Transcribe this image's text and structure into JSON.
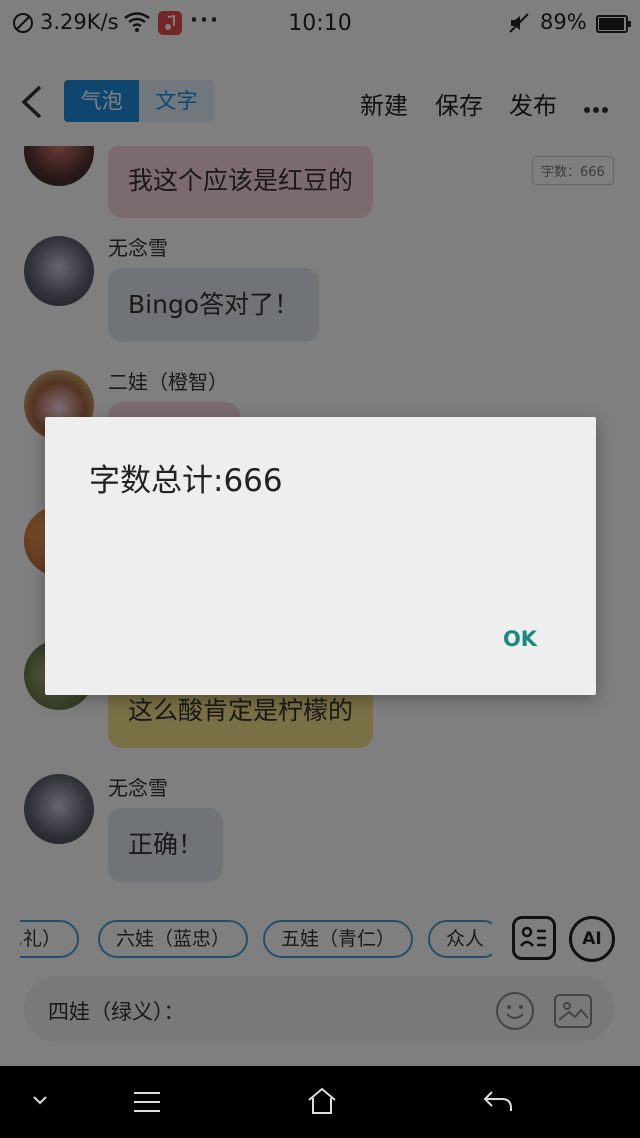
{
  "status_bar": {
    "net_speed": "3.29K/s",
    "time": "10:10",
    "battery": "89%"
  },
  "header": {
    "tab_bubble": "气泡",
    "tab_text": "文字",
    "new_label": "新建",
    "save_label": "保存",
    "publish_label": "发布"
  },
  "chat": {
    "word_count_badge": "字数：666",
    "messages": [
      {
        "name": "",
        "text": "我这个应该是红豆的",
        "color": "#f8d7dc"
      },
      {
        "name": "无念雪",
        "text": "Bingo答对了！",
        "color": "#e0e8f3"
      },
      {
        "name": "二娃（橙智）",
        "text": "",
        "color": "#f8d7dc"
      },
      {
        "name": "",
        "text": "这么酸肯定是柠檬的",
        "color": "#f5e08a"
      },
      {
        "name": "无念雪",
        "text": "正确！",
        "color": "#e0e8f3"
      }
    ]
  },
  "chips": [
    "…礼）",
    "六娃（蓝忠）",
    "五娃（青仁）",
    "众人"
  ],
  "ai_label": "AI",
  "input": {
    "text": "四娃（绿义）："
  },
  "dialog": {
    "title": "字数总计:666",
    "ok_label": "OK"
  },
  "colors": {
    "accent": "#1a8ee0",
    "dialog_button": "#1a8a7e"
  }
}
